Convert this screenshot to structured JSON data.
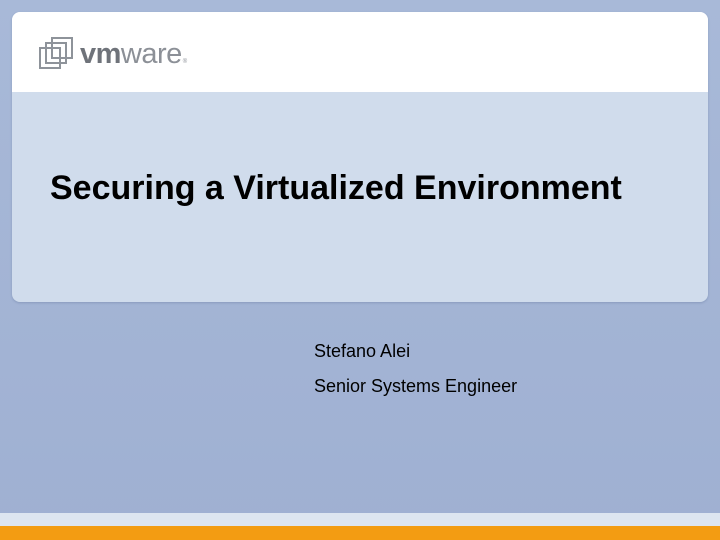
{
  "slide": {
    "logo": {
      "name": "vmware",
      "prefix": "vm",
      "suffix": "ware",
      "mark": "®"
    },
    "title": "Securing a Virtualized Environment",
    "presenter": {
      "name": "Stefano Alei",
      "role": "Senior Systems Engineer"
    }
  },
  "colors": {
    "background": "#a3b3d3",
    "title_panel": "#d0dcec",
    "header_band": "#ffffff",
    "logo_gray": "#6f737a",
    "footer_light": "#dde5f0",
    "footer_accent": "#f39c12"
  }
}
